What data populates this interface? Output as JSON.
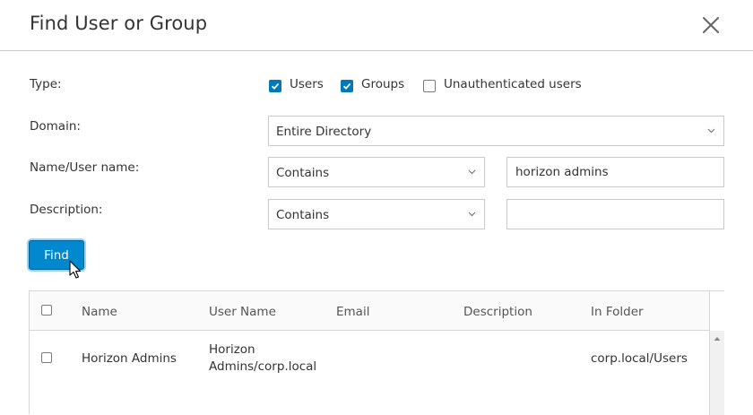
{
  "dialog": {
    "title": "Find User or Group",
    "close_icon": "close-icon"
  },
  "form": {
    "type_label": "Type:",
    "type_options": [
      {
        "label": "Users",
        "checked": true
      },
      {
        "label": "Groups",
        "checked": true
      },
      {
        "label": "Unauthenticated users",
        "checked": false
      }
    ],
    "domain_label": "Domain:",
    "domain_value": "Entire Directory",
    "name_label": "Name/User name:",
    "name_match": "Contains",
    "name_value": "horizon admins",
    "description_label": "Description:",
    "description_match": "Contains",
    "description_value": "",
    "find_label": "Find"
  },
  "results": {
    "columns": [
      "Name",
      "User Name",
      "Email",
      "Description",
      "In Folder"
    ],
    "rows": [
      {
        "checked": false,
        "name": "Horizon Admins",
        "user_name_line1": "Horizon",
        "user_name_line2": "Admins/corp.local",
        "email": "",
        "description": "",
        "in_folder": "corp.local/Users"
      }
    ]
  },
  "colors": {
    "accent": "#0079b8",
    "button": "#0088cf"
  }
}
